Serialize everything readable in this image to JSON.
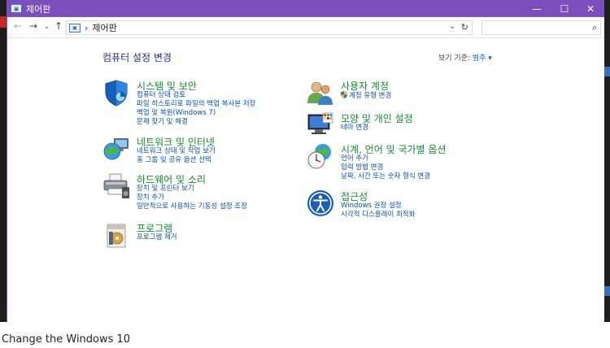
{
  "window": {
    "title": "제어판"
  },
  "address": {
    "separator": "›",
    "path": "제어판",
    "search_placeholder": ""
  },
  "page": {
    "title": "컴퓨터 설정 변경",
    "view_by_label": "보기 기준:",
    "view_by_value": "범주 ▾"
  },
  "categories": {
    "system": {
      "title": "시스템 및 보안",
      "links": [
        "컴퓨터 상태 검토",
        "파일 히스토리로 파일의 백업 복사본 저장",
        "백업 및 복원(Windows 7)",
        "문제 찾기 및 해결"
      ]
    },
    "network": {
      "title": "네트워크 및 인터넷",
      "links": [
        "네트워크 상태 및 작업 보기",
        "홈 그룹 및 공유 옵션 선택"
      ]
    },
    "hardware": {
      "title": "하드웨어 및 소리",
      "links": [
        "장치 및 프린터 보기",
        "장치 추가",
        "일반적으로 사용하는 기동성 설정 조정"
      ]
    },
    "programs": {
      "title": "프로그램",
      "links": [
        "프로그램 제거"
      ]
    },
    "users": {
      "title": "사용자 계정",
      "links": [
        "계정 유형 변경"
      ]
    },
    "appearance": {
      "title": "모양 및 개인 설정",
      "links": [
        "테마 변경"
      ]
    },
    "clock": {
      "title": "시계, 언어 및 국가별 옵션",
      "links": [
        "언어 추가",
        "입력 방법 변경",
        "날짜, 시간 또는 숫자 형식 변경"
      ]
    },
    "access": {
      "title": "접근성",
      "links": [
        "Windows 권장 설정",
        "시각적 디스플레이 최적화"
      ]
    }
  },
  "background": {
    "bottom_text": "Change the Windows 10"
  },
  "colors": {
    "titlebar": "#7c4dbd",
    "link": "#0b4fa8",
    "category_title": "#148a2e",
    "page_title": "#1e3287"
  }
}
